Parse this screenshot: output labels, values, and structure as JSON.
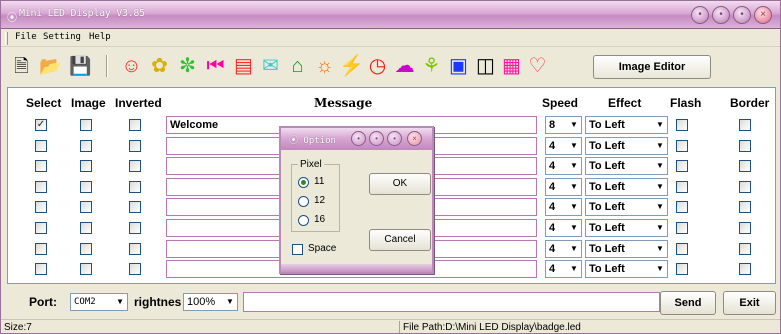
{
  "window": {
    "title": "Mini LED Display V3.85",
    "buttons": [
      "minimize",
      "restore",
      "maximize",
      "close"
    ]
  },
  "menu": {
    "items": [
      "File",
      "Setting",
      "Help"
    ]
  },
  "toolbar": {
    "icons": [
      "new-file-icon",
      "open-folder-icon",
      "save-icon",
      "smiley-icon",
      "cat-icon",
      "snail-icon",
      "rewind-icon",
      "building-icon",
      "mail-icon",
      "house-icon",
      "sun-icon",
      "lightning-icon",
      "clock-icon",
      "chat-icon",
      "plant-icon",
      "bus-icon",
      "computer-icon",
      "floppy-icon",
      "heart-icon"
    ],
    "image_editor_label": "Image Editor"
  },
  "table": {
    "headers": {
      "select": "Select",
      "image": "Image",
      "inverted": "Inverted",
      "message": "Message",
      "speed": "Speed",
      "effect": "Effect",
      "flash": "Flash",
      "border": "Border"
    },
    "rows": [
      {
        "select": true,
        "image": false,
        "inverted": false,
        "message": "Welcome",
        "speed": "8",
        "effect": "To Left",
        "flash": false,
        "border": false
      },
      {
        "select": false,
        "image": false,
        "inverted": false,
        "message": "",
        "speed": "4",
        "effect": "To Left",
        "flash": false,
        "border": false
      },
      {
        "select": false,
        "image": false,
        "inverted": false,
        "message": "",
        "speed": "4",
        "effect": "To Left",
        "flash": false,
        "border": false
      },
      {
        "select": false,
        "image": false,
        "inverted": false,
        "message": "",
        "speed": "4",
        "effect": "To Left",
        "flash": false,
        "border": false
      },
      {
        "select": false,
        "image": false,
        "inverted": false,
        "message": "",
        "speed": "4",
        "effect": "To Left",
        "flash": false,
        "border": false
      },
      {
        "select": false,
        "image": false,
        "inverted": false,
        "message": "",
        "speed": "4",
        "effect": "To Left",
        "flash": false,
        "border": false
      },
      {
        "select": false,
        "image": false,
        "inverted": false,
        "message": "",
        "speed": "4",
        "effect": "To Left",
        "flash": false,
        "border": false
      },
      {
        "select": false,
        "image": false,
        "inverted": false,
        "message": "",
        "speed": "4",
        "effect": "To Left",
        "flash": false,
        "border": false
      }
    ]
  },
  "bottom": {
    "port_label": "Port:",
    "port_value": "COM2",
    "brightness_label": "rightnes",
    "brightness_value": "100%",
    "send_label": "Send",
    "exit_label": "Exit"
  },
  "status": {
    "size": "Size:7",
    "file_path": "File Path:D:\\Mini LED Display\\badge.led"
  },
  "option_dialog": {
    "title": "Option",
    "pixel_group_label": "Pixel",
    "pixel_options": [
      "11",
      "12",
      "16"
    ],
    "pixel_selected": "11",
    "ok_label": "OK",
    "cancel_label": "Cancel",
    "space_label": "Space",
    "space_checked": false
  },
  "colors": {
    "title_bar": "#d9a9d4",
    "accent_border": "#b977b3",
    "face": "#ece9d8"
  }
}
